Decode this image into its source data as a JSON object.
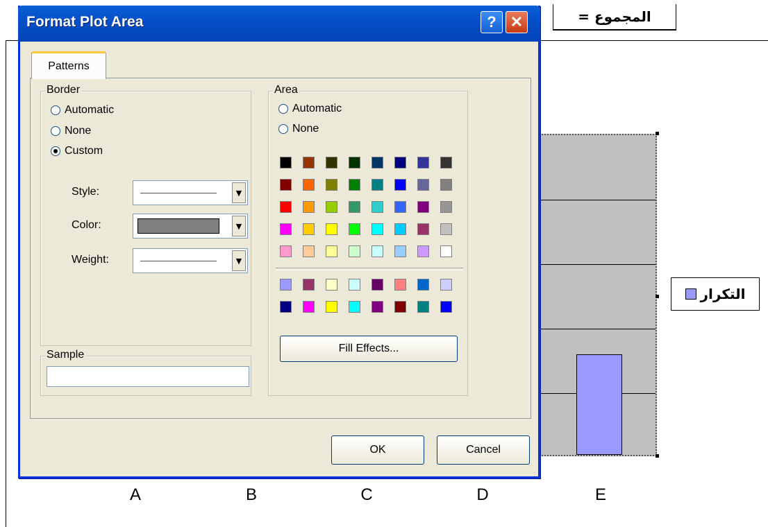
{
  "dialog": {
    "title": "Format Plot Area",
    "help_label": "?",
    "close_label": "✕",
    "tab_label": "Patterns",
    "border": {
      "legend": "Border",
      "automatic": "Automatic",
      "none": "None",
      "custom": "Custom",
      "selected": "custom",
      "style_label": "Style:",
      "color_label": "Color:",
      "weight_label": "Weight:",
      "color_value": "#808080"
    },
    "sample_legend": "Sample",
    "area": {
      "legend": "Area",
      "automatic": "Automatic",
      "none": "None",
      "fill_effects": "Fill Effects...",
      "palette": [
        [
          "#000000",
          "#993300",
          "#333300",
          "#003300",
          "#003366",
          "#000080",
          "#333399",
          "#333333"
        ],
        [
          "#800000",
          "#ff6600",
          "#808000",
          "#008000",
          "#008080",
          "#0000ff",
          "#666699",
          "#808080"
        ],
        [
          "#ff0000",
          "#ff9900",
          "#99cc00",
          "#339966",
          "#33cccc",
          "#3366ff",
          "#800080",
          "#969696"
        ],
        [
          "#ff00ff",
          "#ffcc00",
          "#ffff00",
          "#00ff00",
          "#00ffff",
          "#00ccff",
          "#993366",
          "#c0c0c0"
        ],
        [
          "#ff99cc",
          "#ffcc99",
          "#ffff99",
          "#ccffcc",
          "#ccffff",
          "#99ccff",
          "#cc99ff",
          "#ffffff"
        ]
      ],
      "palette_extra": [
        [
          "#9999ff",
          "#993366",
          "#ffffcc",
          "#ccffff",
          "#660066",
          "#ff8080",
          "#0066cc",
          "#ccccff"
        ],
        [
          "#000080",
          "#ff00ff",
          "#ffff00",
          "#00ffff",
          "#800080",
          "#800000",
          "#008080",
          "#0000ff"
        ]
      ]
    },
    "ok_label": "OK",
    "cancel_label": "Cancel"
  },
  "sheet": {
    "sum_label": "المجموع ="
  },
  "chart_data": {
    "type": "bar",
    "categories": [
      "A",
      "B",
      "C",
      "D",
      "E"
    ],
    "legend_label": "التكرار",
    "plot_color": "#c0c0c0",
    "series_color": "#9999ff",
    "gridline_count": 5
  }
}
